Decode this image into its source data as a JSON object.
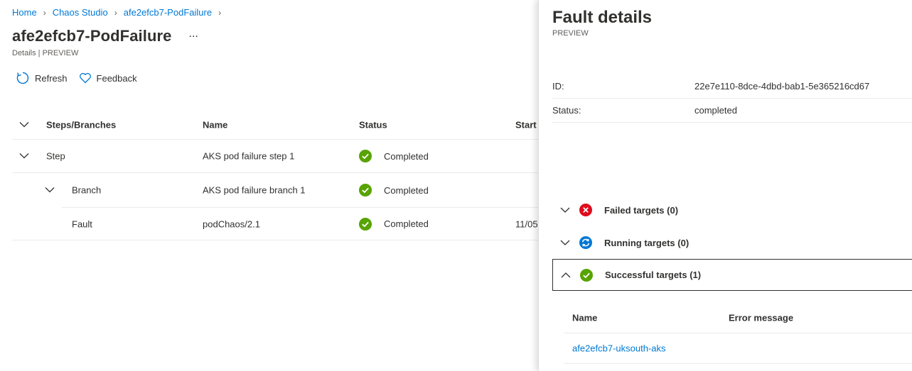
{
  "breadcrumb": [
    "Home",
    "Chaos Studio",
    "afe2efcb7-PodFailure"
  ],
  "page": {
    "title": "afe2efcb7-PodFailure",
    "more": "...",
    "subtitle": "Details | PREVIEW"
  },
  "toolbar": {
    "refresh": "Refresh",
    "feedback": "Feedback"
  },
  "grid": {
    "columns": [
      "Steps/Branches",
      "Name",
      "Status",
      "Start"
    ],
    "rows": [
      {
        "type": "Step",
        "name": "AKS pod failure step 1",
        "status": "Completed",
        "start": ""
      },
      {
        "type": "Branch",
        "name": "AKS pod failure branch 1",
        "status": "Completed",
        "start": ""
      },
      {
        "type": "Fault",
        "name": "podChaos/2.1",
        "status": "Completed",
        "start": "11/05"
      }
    ]
  },
  "panel": {
    "title": "Fault details",
    "subtitle": "PREVIEW",
    "props": [
      {
        "key": "ID:",
        "value": "22e7e110-8dce-4dbd-bab1-5e365216cd67"
      },
      {
        "key": "Status:",
        "value": "completed"
      }
    ],
    "sections": [
      {
        "label": "Failed targets (0)",
        "icon": "error-icon"
      },
      {
        "label": "Running targets (0)",
        "icon": "sync-icon"
      },
      {
        "label": "Successful targets (1)",
        "icon": "success-icon"
      }
    ],
    "targets": {
      "columns": [
        "Name",
        "Error message"
      ],
      "rows": [
        {
          "name": "afe2efcb7-uksouth-aks",
          "error": ""
        }
      ]
    }
  },
  "colors": {
    "accent": "#0078d4",
    "success": "#57a300",
    "error": "#e00b1c",
    "running": "#0078d4"
  }
}
